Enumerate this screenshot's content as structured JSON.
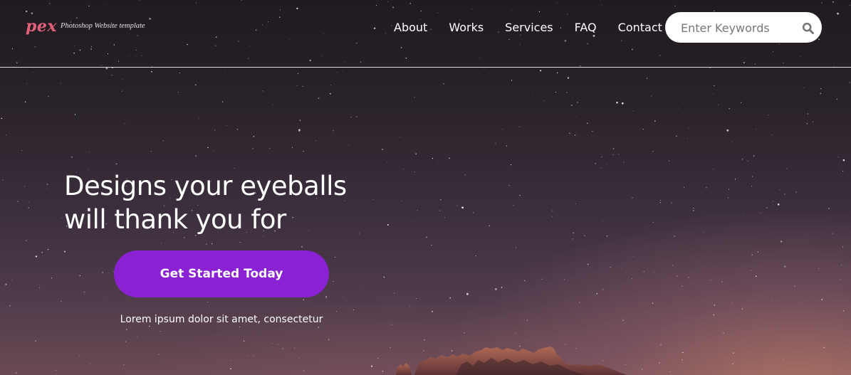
{
  "brand": {
    "logo": "pex",
    "tagline": "Photoshop Website template",
    "logo_color": "#e2607a"
  },
  "nav": {
    "items": [
      {
        "label": "About"
      },
      {
        "label": "Works"
      },
      {
        "label": "Services"
      },
      {
        "label": "FAQ"
      },
      {
        "label": "Contact"
      }
    ]
  },
  "search": {
    "placeholder": "Enter Keywords",
    "icon": "search-icon"
  },
  "hero": {
    "headline_line1": "Designs your eyeballs",
    "headline_line2": "will thank you for",
    "cta_label": "Get Started Today",
    "cta_color": "#8a21d3",
    "subtext": "Lorem ipsum dolor sit amet, consectetur"
  }
}
